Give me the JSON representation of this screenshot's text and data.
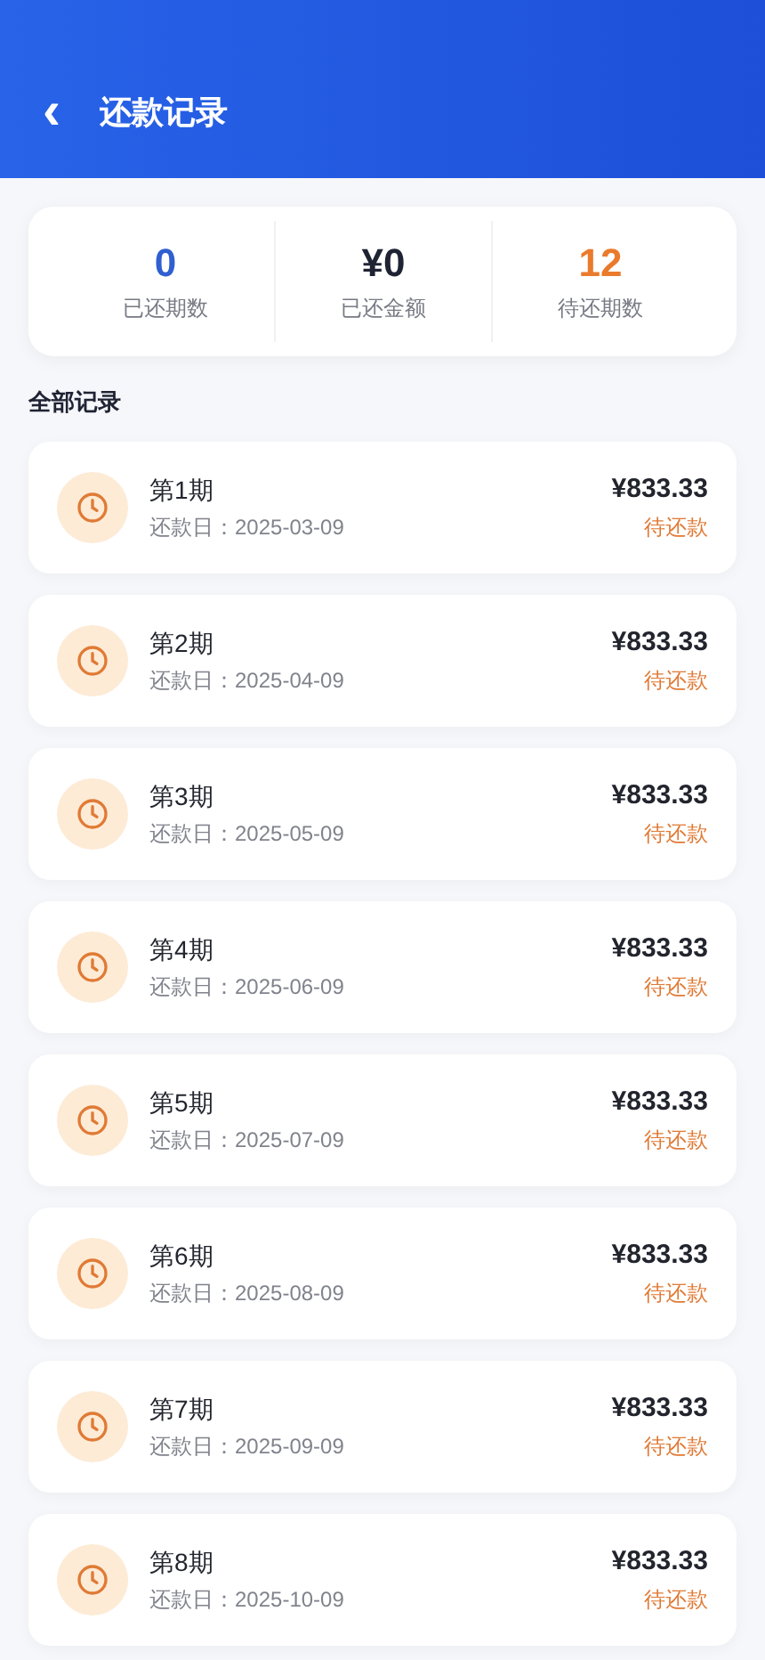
{
  "header": {
    "back": "‹",
    "title": "还款记录"
  },
  "summary": [
    {
      "value": "0",
      "label": "已还期数",
      "color": "#2f5fd0"
    },
    {
      "value": "¥0",
      "label": "已还金额",
      "color": "#1f2333"
    },
    {
      "value": "12",
      "label": "待还期数",
      "color": "#ea7a2c"
    }
  ],
  "section_title": "全部记录",
  "records": [
    {
      "period": "第1期",
      "date": "还款日：2025-03-09",
      "amount": "¥833.33",
      "status": "待还款",
      "paid": false
    },
    {
      "period": "第2期",
      "date": "还款日：2025-04-09",
      "amount": "¥833.33",
      "status": "待还款",
      "paid": false
    },
    {
      "period": "第3期",
      "date": "还款日：2025-05-09",
      "amount": "¥833.33",
      "status": "待还款",
      "paid": false
    },
    {
      "period": "第4期",
      "date": "还款日：2025-06-09",
      "amount": "¥833.33",
      "status": "待还款",
      "paid": false
    },
    {
      "period": "第5期",
      "date": "还款日：2025-07-09",
      "amount": "¥833.33",
      "status": "待还款",
      "paid": false
    },
    {
      "period": "第6期",
      "date": "还款日：2025-08-09",
      "amount": "¥833.33",
      "status": "待还款",
      "paid": false
    },
    {
      "period": "第7期",
      "date": "还款日：2025-09-09",
      "amount": "¥833.33",
      "status": "待还款",
      "paid": false
    },
    {
      "period": "第8期",
      "date": "还款日：2025-10-09",
      "amount": "¥833.33",
      "status": "待还款",
      "paid": false
    }
  ]
}
